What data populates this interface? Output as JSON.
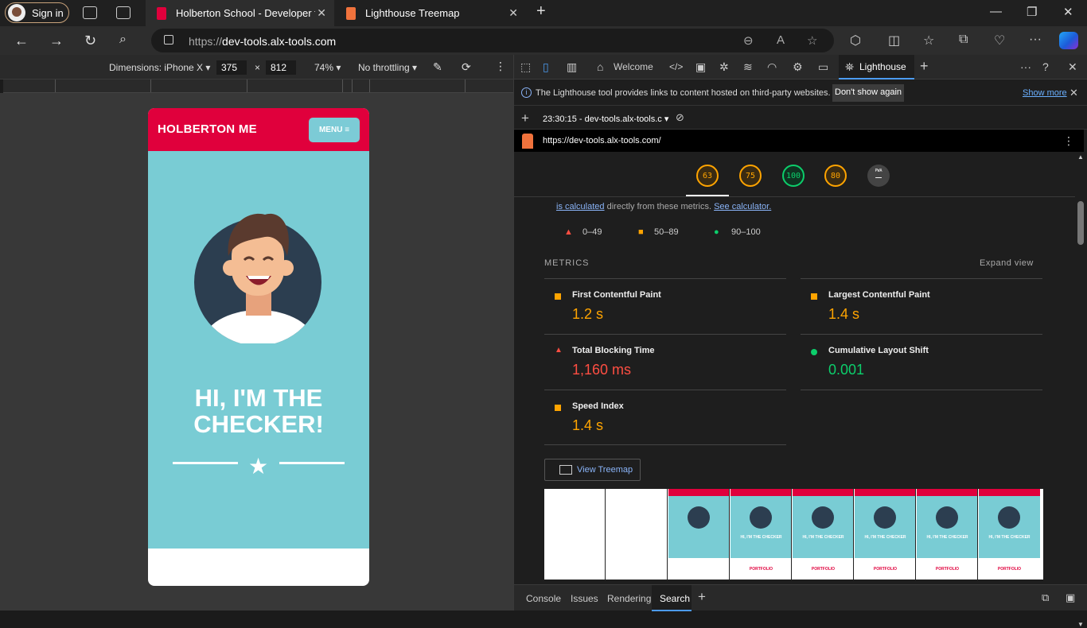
{
  "browser": {
    "sign_in": "Sign in",
    "tabs": [
      {
        "title": "Holberton School - Developer to"
      },
      {
        "title": "Lighthouse Treemap"
      }
    ],
    "new_tab_icon": "plus-icon",
    "url": "https://dev-tools.alx-tools.com",
    "url_prefix": "https://",
    "url_host": "dev-tools.alx-tools.com"
  },
  "device_toolbar": {
    "dimensions_label": "Dimensions: iPhone X",
    "width": "375",
    "times": "×",
    "height": "812",
    "zoom": "74%",
    "throttling": "No throttling"
  },
  "page": {
    "site_title": "HOLBERTON ME",
    "menu_button": "MENU ≡",
    "hero_heading": "HI, I'M THE CHECKER!",
    "accent_color": "#e0003c",
    "hero_color": "#79ccd4"
  },
  "devtools": {
    "tabs": [
      {
        "label": "Welcome"
      },
      {
        "label": "Lighthouse"
      }
    ],
    "info_message": "The Lighthouse tool provides links to content hosted on third-party websites.",
    "dont_show_again": "Don't show again",
    "show_more": "Show more",
    "report_select": "23:30:15 - dev-tools.alx-tools.c",
    "report_url": "https://dev-tools.alx-tools.com/",
    "gauges": [
      {
        "score": "63",
        "color": "#ffa400"
      },
      {
        "score": "75",
        "color": "#ffa400"
      },
      {
        "score": "100",
        "color": "#0cce6b"
      },
      {
        "score": "80",
        "color": "#ffa400"
      },
      {
        "score": "–",
        "sublabel": "PWA",
        "color": "#888888"
      }
    ],
    "calc_link": "is calculated",
    "calc_text": " directly from these metrics. ",
    "calculator_link": "See calculator.",
    "legend": [
      {
        "range": "0–49",
        "color": "#ff4e42"
      },
      {
        "range": "50–89",
        "color": "#ffa400"
      },
      {
        "range": "90–100",
        "color": "#0cce6b"
      }
    ],
    "metrics_heading": "METRICS",
    "expand_view": "Expand view",
    "metrics": [
      {
        "name": "First Contentful Paint",
        "value": "1.2 s",
        "color": "#ffa400"
      },
      {
        "name": "Largest Contentful Paint",
        "value": "1.4 s",
        "color": "#ffa400"
      },
      {
        "name": "Total Blocking Time",
        "value": "1,160 ms",
        "color": "#ff4e42"
      },
      {
        "name": "Cumulative Layout Shift",
        "value": "0.001",
        "color": "#0cce6b"
      },
      {
        "name": "Speed Index",
        "value": "1.4 s",
        "color": "#ffa400"
      }
    ],
    "view_treemap": "View Treemap",
    "filmstrip": {
      "heading": "HI, I'M THE CHECKER",
      "portfolio": "PORTFOLIO"
    },
    "drawer_tabs": [
      "Console",
      "Issues",
      "Rendering",
      "Search"
    ]
  }
}
